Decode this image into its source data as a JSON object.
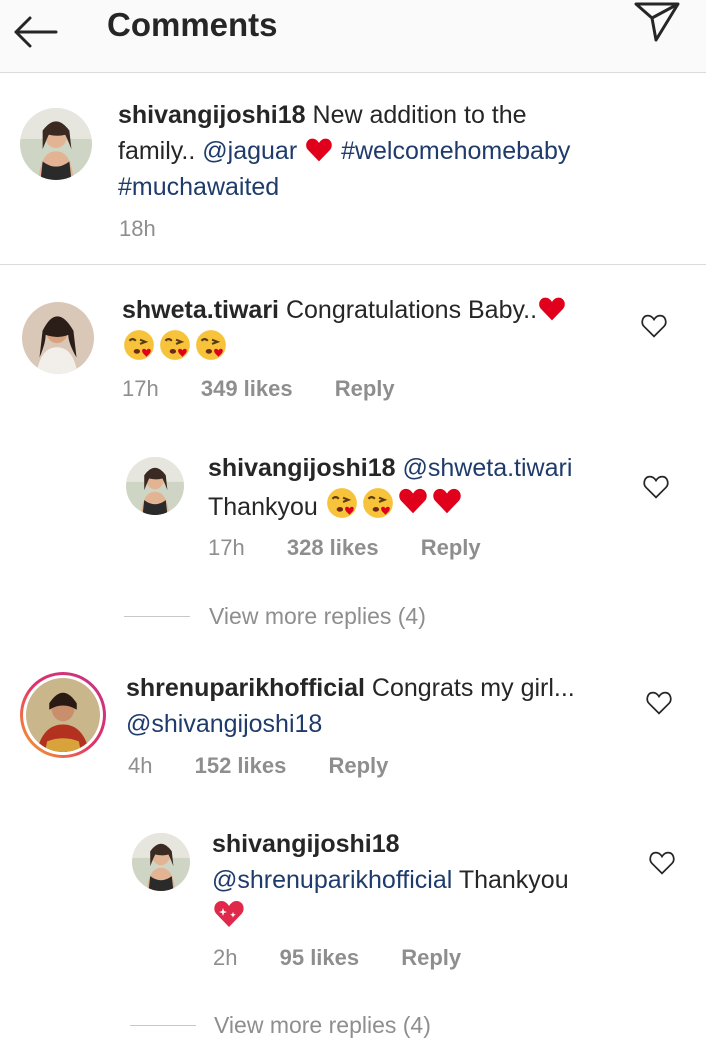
{
  "header": {
    "title": "Comments",
    "back_icon": "arrow-left-icon",
    "send_icon": "paper-plane-icon"
  },
  "caption": {
    "username": "shivangijoshi18",
    "text_1": "New addition to the",
    "text_2": "family..",
    "mention": "@jaguar",
    "hashtag_1": "#welcomehomebaby",
    "hashtag_2": "#muchawaited",
    "time": "18h"
  },
  "comments": [
    {
      "username": "shweta.tiwari",
      "text": "Congratulations Baby..",
      "time": "17h",
      "likes": "349 likes",
      "reply": "Reply"
    },
    {
      "username": "shivangijoshi18",
      "mention": "@shweta.tiwari",
      "text": "Thankyou",
      "time": "17h",
      "likes": "328 likes",
      "reply": "Reply"
    },
    {
      "username": "shrenuparikhofficial",
      "text": "Congrats my girl...",
      "mention": "@shivangijoshi18",
      "time": "4h",
      "likes": "152 likes",
      "reply": "Reply"
    },
    {
      "username": "shivangijoshi18",
      "mention": "@shrenuparikhofficial",
      "text": "Thankyou",
      "time": "2h",
      "likes": "95 likes",
      "reply": "Reply"
    }
  ],
  "view_more_1": "View more replies (4)",
  "view_more_2": "View more replies (4)",
  "colors": {
    "link": "#1e3b6b",
    "muted": "#8e8e8e",
    "heart_red": "#e0001b",
    "header_bg": "#fafafa"
  }
}
